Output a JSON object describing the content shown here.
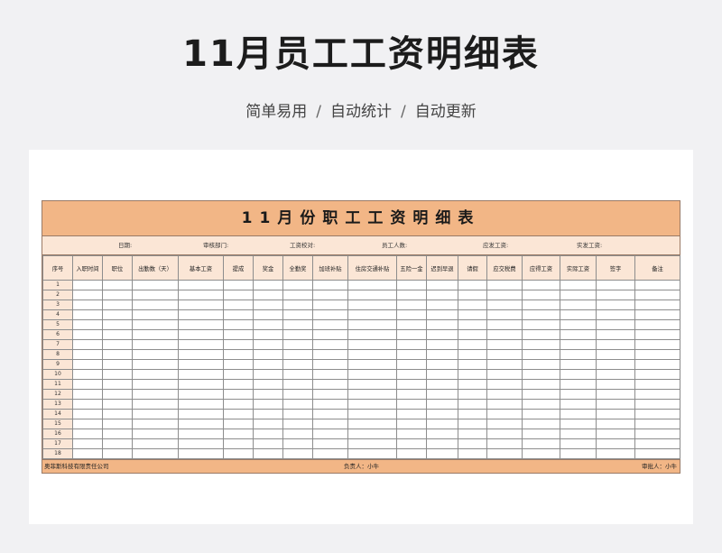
{
  "page": {
    "title": "11月员工工资明细表",
    "subtitle_parts": [
      "简单易用",
      "自动统计",
      "自动更新"
    ],
    "separator": "/"
  },
  "sheet": {
    "title": "11月份职工工资明细表",
    "info_fields": [
      "日期:",
      "审核部门:",
      "工资校对:",
      "员工人数:",
      "应发工资:",
      "实发工资:"
    ],
    "columns": [
      "序号",
      "入职时间",
      "职位",
      "出勤数（天）",
      "基本工资",
      "提成",
      "奖金",
      "全勤奖",
      "加班补贴",
      "住房交通补贴",
      "五险一金",
      "迟到早退",
      "请假",
      "应交税费",
      "应得工资",
      "实际工资",
      "签字",
      "备注"
    ],
    "rows": [
      "1",
      "2",
      "3",
      "4",
      "5",
      "6",
      "7",
      "8",
      "9",
      "10",
      "11",
      "12",
      "13",
      "14",
      "15",
      "16",
      "17",
      "18"
    ],
    "footer": {
      "company": "奥菲斯科技有限责任公司",
      "responsible": "负责人：小牛",
      "approver": "审批人：小牛"
    },
    "colors": {
      "title_bg": "#f2b686",
      "header_bg": "#fbe6d6",
      "border": "#8d8d8d"
    }
  }
}
